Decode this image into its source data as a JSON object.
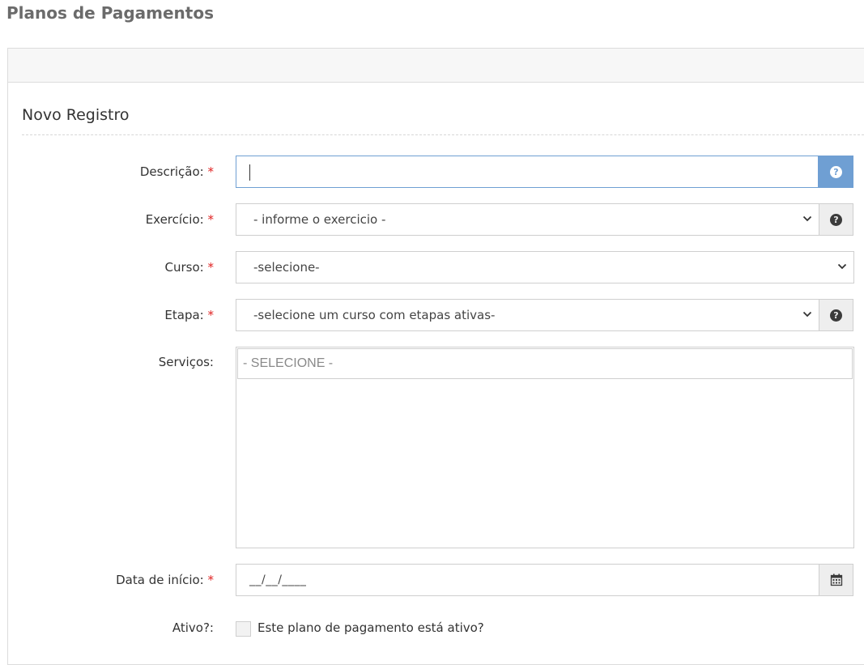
{
  "page": {
    "title": "Planos de Pagamentos"
  },
  "form": {
    "title": "Novo Registro",
    "required_mark": "*",
    "fields": {
      "descricao": {
        "label": "Descrição:",
        "value": "",
        "help_icon": "question-circle-icon"
      },
      "exercicio": {
        "label": "Exercício:",
        "selected": "- informe o exercicio -",
        "help_icon": "question-circle-icon"
      },
      "curso": {
        "label": "Curso:",
        "selected": "-selecione-"
      },
      "etapa": {
        "label": "Etapa:",
        "selected": "-selecione um curso com etapas ativas-",
        "help_icon": "question-circle-icon"
      },
      "servicos": {
        "label": "Serviços:",
        "placeholder": "- SELECIONE -"
      },
      "data_inicio": {
        "label": "Data de início:",
        "value": "__/__/____",
        "icon": "calendar-icon"
      },
      "ativo": {
        "label": "Ativo?:",
        "checkbox_label": "Este plano de pagamento está ativo?",
        "checked": false
      }
    }
  },
  "colors": {
    "focus_border": "#6f9fd3",
    "required": "#e02222",
    "addon_bg": "#eeeeee"
  }
}
